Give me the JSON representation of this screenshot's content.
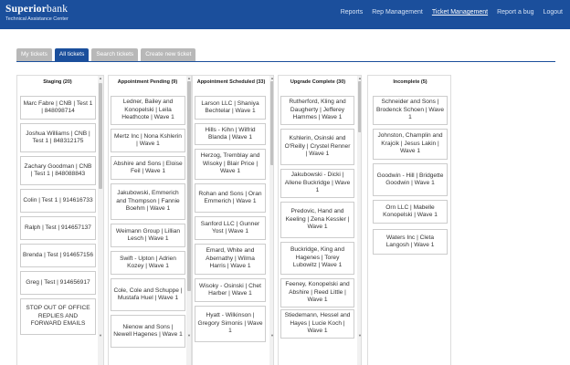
{
  "brand": {
    "name_bold": "Superior",
    "name_rest": "bank",
    "subtitle": "Technical Assistance Center"
  },
  "nav": [
    "Reports",
    "Rep Management",
    "Ticket Management",
    "Report a bug",
    "Logout"
  ],
  "nav_active": "Ticket Management",
  "tabs": [
    "My tickets",
    "All tickets",
    "Search tickets",
    "Create new ticket"
  ],
  "tab_active": "All tickets",
  "colors": {
    "brand_blue": "#1b4f9c",
    "tab_inactive": "#b8b8b8"
  },
  "columns": [
    {
      "title": "Staging (20)",
      "cards": [
        "Marc Fabre | CNB | Test 1 | 848098714",
        "Joshua Williams | CNB | Test 1 | 848312175",
        "Zachary Goodman | CNB | Test 1 | 848088843",
        "Colin | Test 1 | 914616733",
        "Ralph | Test | 914657137",
        "Brenda | Test | 914657156",
        "Greg | Test | 914656917",
        "STOP OUT OF OFFICE REPLIES AND FORWARD EMAILS"
      ]
    },
    {
      "title": "Appointment Pending (9)",
      "cards": [
        "Ledner, Bailey and Konopelski | Leila Heathcote | Wave 1",
        "Mertz Inc | Nona Kshlerin | Wave 1",
        "Abshire and Sons | Eloise Feil | Wave 1",
        "Jakubowski, Emmerich and Thompson | Fannie Boehm | Wave 1",
        "Weimann Group | Lillian Lesch | Wave 1",
        "Swift - Upton | Adrien Kozey | Wave 1",
        "Cole, Cole and Schuppe | Mustafa Huel | Wave 1",
        "Nienow and Sons | Newell Hagenes | Wave 1"
      ]
    },
    {
      "title": "Appointment Scheduled (33)",
      "cards": [
        "Larson LLC | Shaniya Bechtelar | Wave 1",
        "Hills - Kihn | Wilfrid Blanda | Wave 1",
        "Herzog, Tremblay and Wisoky | Blair Price | Wave 1",
        "Rohan and Sons | Oran Emmerich | Wave 1",
        "Sanford LLC | Gunner Yost | Wave 1",
        "Emard, White and Abernathy | Wilma Harris | Wave 1",
        "Wisoky - Osinski | Chet Harber | Wave 1",
        "Hyatt - Wilkinson | Gregory Simonis | Wave 1"
      ]
    },
    {
      "title": "Upgrade Complete (30)",
      "cards": [
        "Rutherford, Kling and Daugherty | Jefferey Hammes | Wave 1",
        "Kshlerin, Osinski and O'Reilly | Crystel Renner | Wave 1",
        "Jakubowski - Dicki | Allene Buckridge | Wave 1",
        "Predovic, Hand and Keeling | Zena Kessler | Wave 1",
        "Buckridge, King and Hagenes | Torey Lubowitz | Wave 1",
        "Feeney, Konopelski and Abshire | Reed Little | Wave 1",
        "Stiedemann, Hessel and Hayes | Lucie Koch | Wave 1"
      ]
    },
    {
      "title": "Incomplete (5)",
      "cards": [
        "Schneider and Sons | Brodenck Schoen | Wave 1",
        "Johnston, Champlin and Krajcik | Jesus Lakin | Wave 1",
        "Goodwin - Hill | Bridgette Goodwin | Wave 1",
        "Orn LLC | Mabelle Konopelski | Wave 1",
        "Waters Inc | Cleta Langosh | Wave 1"
      ]
    }
  ]
}
